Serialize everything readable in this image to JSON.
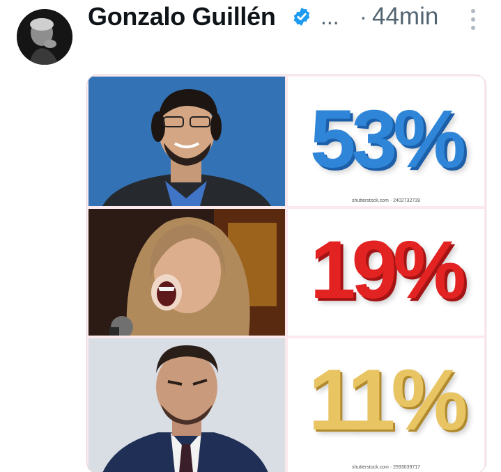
{
  "post": {
    "author_name": "Gonzalo Guillén",
    "ellipsis": "...",
    "separator": "·",
    "time": "44min"
  },
  "colors": {
    "verified_badge": "#1d9bf0",
    "pct_53": "#2f86d8",
    "pct_19": "#e32222",
    "pct_11": "#e8c463"
  },
  "icons": {
    "verified": "verified-badge-icon",
    "more": "more-vertical-icon"
  },
  "media": {
    "rows": [
      {
        "percent_text": "53%",
        "watermark": "shutterstock.com · 2402732739"
      },
      {
        "percent_text": "19%",
        "watermark": ""
      },
      {
        "percent_text": "11%",
        "watermark": "shutterstock.com · 2593039717"
      }
    ]
  }
}
